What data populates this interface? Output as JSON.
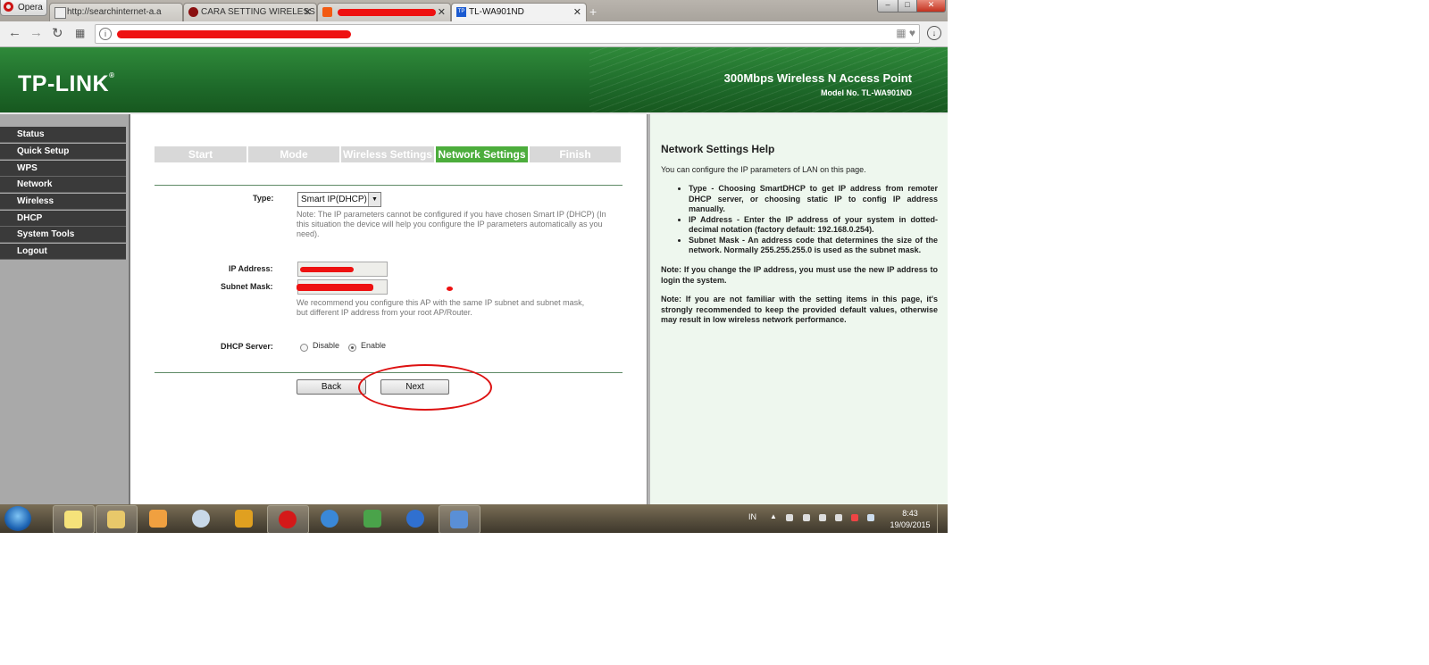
{
  "browser": {
    "opera_label": "Opera",
    "tabs": [
      {
        "title": "http://searchinternet-a.a",
        "active": false
      },
      {
        "title": "CARA SETTING WIRELESS",
        "active": false
      },
      {
        "title": "",
        "active": false
      },
      {
        "title": "TL-WA901ND",
        "active": true
      }
    ],
    "newtab_icon": "+",
    "win": {
      "min": "–",
      "max": "□",
      "close": "✕"
    }
  },
  "header": {
    "logo": "TP-LINK",
    "product": "300Mbps Wireless N Access Point",
    "model": "Model No. TL-WA901ND"
  },
  "menu": [
    "Status",
    "Quick Setup",
    "WPS",
    "Network",
    "Wireless",
    "DHCP",
    "System Tools",
    "Logout"
  ],
  "steps": [
    {
      "label": "Start",
      "active": false
    },
    {
      "label": "Mode",
      "active": false
    },
    {
      "label": "Wireless Settings",
      "active": false
    },
    {
      "label": "Network Settings",
      "active": true
    },
    {
      "label": "Finish",
      "active": false
    }
  ],
  "form": {
    "type_label": "Type:",
    "type_value": "Smart IP(DHCP)",
    "type_note": "Note: The IP parameters cannot be configured if you have chosen Smart IP (DHCP) (In this situation the device will help you configure the IP parameters automatically as you need).",
    "ip_label": "IP Address:",
    "mask_label": "Subnet Mask:",
    "recommend_note": "We recommend you configure this AP with the same IP subnet and subnet mask, but different IP address from your root AP/Router.",
    "dhcp_label": "DHCP Server:",
    "dhcp_disable": "Disable",
    "dhcp_enable": "Enable",
    "back": "Back",
    "next": "Next"
  },
  "help": {
    "title": "Network Settings Help",
    "intro": "You can configure the IP parameters of LAN on this page.",
    "items": [
      "Type - Choosing SmartDHCP to get IP address from remoter DHCP server, or choosing static IP to config IP address manually.",
      "IP Address - Enter the IP address of your system in dotted-decimal notation (factory default: 192.168.0.254).",
      "Subnet Mask - An address code that determines the size of the network. Normally 255.255.255.0 is used as the subnet mask."
    ],
    "note1": "Note: If you change the IP address, you must use the new IP address to login the system.",
    "note2": "Note: If you are not familiar with the setting items in this page, it's strongly recommended to keep the provided default values, otherwise may result in low wireless network performance."
  },
  "taskbar": {
    "lang": "IN",
    "time": "8:43",
    "date": "19/09/2015"
  },
  "colors": {
    "green_header": "#1e6a2a",
    "step_active": "#4cad3c",
    "redaction": "#ee1111"
  }
}
